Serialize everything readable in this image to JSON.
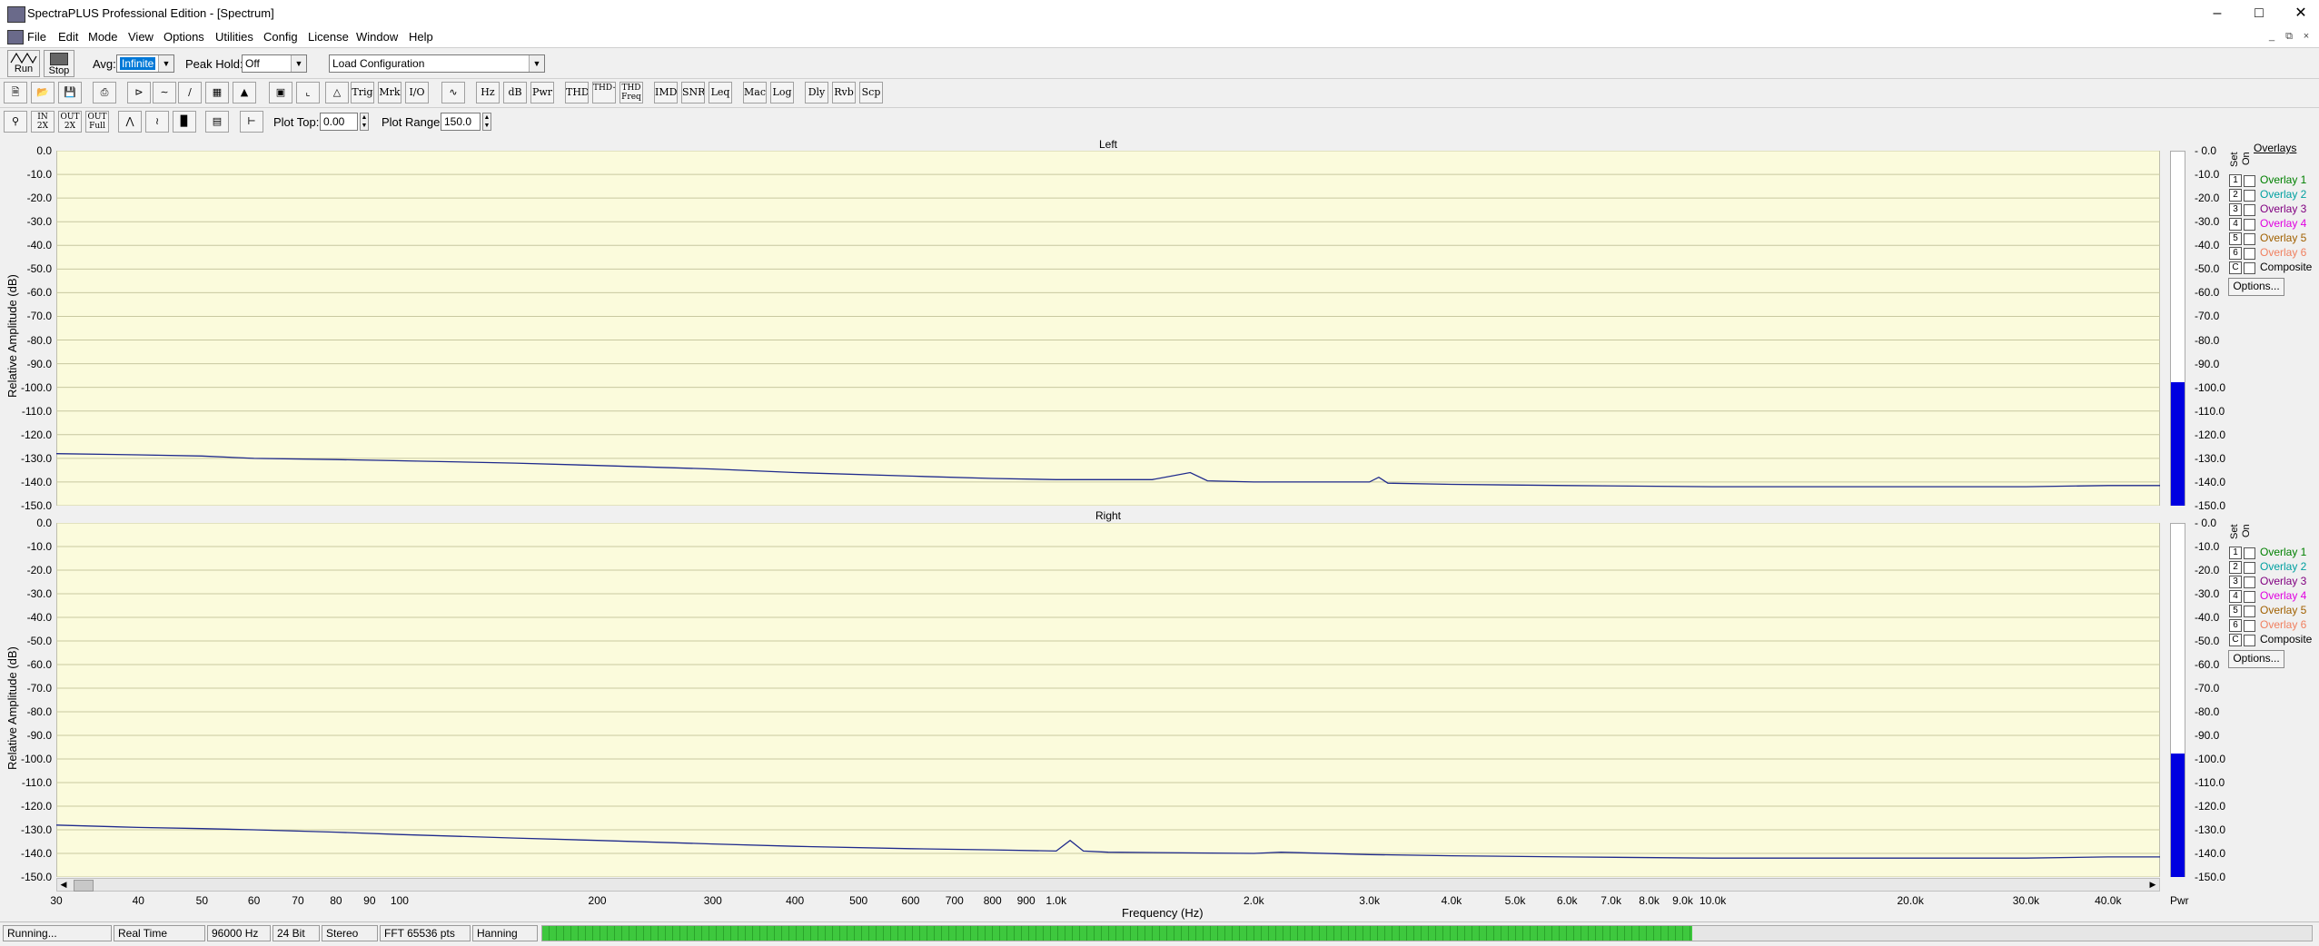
{
  "window": {
    "title": "SpectraPLUS Professional Edition - [Spectrum]"
  },
  "menu": [
    "File",
    "Edit",
    "Mode",
    "View",
    "Options",
    "Utilities",
    "Config",
    "License",
    "Window",
    "Help"
  ],
  "toolbar1": {
    "run_label": "Run",
    "stop_label": "Stop",
    "avg_label": "Avg:",
    "avg_value": "Infinite",
    "peak_label": "Peak Hold:",
    "peak_value": "Off",
    "config_value": "Load Configuration"
  },
  "toolbar2": {
    "buttons": [
      "Trig",
      "Mrk",
      "I/O",
      "Hz",
      "dB",
      "Pwr",
      "THD",
      "THD+N",
      "THD Freq",
      "IMD",
      "SNR",
      "Leq",
      "Mac",
      "Log",
      "Dly",
      "Rvb",
      "Scp"
    ]
  },
  "toolbar3": {
    "zoom_labels": [
      "IN 2X",
      "OUT 2X",
      "OUT Full"
    ],
    "plot_top_label": "Plot Top:",
    "plot_top_value": "0.00",
    "plot_range_label": "Plot Range:",
    "plot_range_value": "150.0"
  },
  "plots": {
    "left_title": "Left",
    "right_title": "Right",
    "ylabel": "Relative Amplitude (dB)",
    "xlabel": "Frequency (Hz)",
    "y_ticks": [
      "0.0",
      "-10.0",
      "-20.0",
      "-30.0",
      "-40.0",
      "-50.0",
      "-60.0",
      "-70.0",
      "-80.0",
      "-90.0",
      "-100.0",
      "-110.0",
      "-120.0",
      "-130.0",
      "-140.0",
      "-150.0"
    ],
    "x_ticks": [
      "30",
      "40",
      "50",
      "60",
      "70",
      "80",
      "90",
      "100",
      "200",
      "300",
      "400",
      "500",
      "600",
      "700",
      "800",
      "900",
      "1.0k",
      "2.0k",
      "3.0k",
      "4.0k",
      "5.0k",
      "6.0k",
      "7.0k",
      "8.0k",
      "9.0k",
      "10.0k",
      "20.0k",
      "30.0k",
      "40.0k"
    ],
    "pwr_label": "Pwr",
    "plot_bg": "#fbfbdc",
    "trace_color": "#1f2a8c",
    "meter_color": "#0000e0"
  },
  "overlays": {
    "header": "Overlays",
    "set_label": "Set",
    "on_label": "On",
    "items": [
      {
        "num": "1",
        "name": "Overlay 1",
        "color": "#008000"
      },
      {
        "num": "2",
        "name": "Overlay 2",
        "color": "#00a0a0"
      },
      {
        "num": "3",
        "name": "Overlay 3",
        "color": "#800080"
      },
      {
        "num": "4",
        "name": "Overlay 4",
        "color": "#e000e0"
      },
      {
        "num": "5",
        "name": "Overlay 5",
        "color": "#a06000"
      },
      {
        "num": "6",
        "name": "Overlay 6",
        "color": "#f08060"
      },
      {
        "num": "C",
        "name": "Composite",
        "color": "#000000"
      }
    ],
    "options_label": "Options..."
  },
  "chart_data": [
    {
      "type": "line",
      "title": "Left",
      "xlabel": "Frequency (Hz)",
      "ylabel": "Relative Amplitude (dB)",
      "x_scale": "log",
      "xlim": [
        30,
        48000
      ],
      "ylim": [
        -150,
        0
      ],
      "grid": true,
      "series": [
        {
          "x": [
            30,
            40,
            50,
            60,
            80,
            100,
            150,
            200,
            300,
            400,
            600,
            800,
            1000,
            1400,
            1600,
            1700,
            2000,
            3000,
            3100,
            3200,
            4000,
            6000,
            10000,
            20000,
            30000,
            40000,
            48000
          ],
          "values": [
            -128,
            -128.5,
            -129,
            -130,
            -130.5,
            -131,
            -132,
            -133,
            -134.5,
            -136,
            -137.5,
            -138.5,
            -139,
            -139,
            -136,
            -139.5,
            -140,
            -140,
            -138,
            -140.5,
            -141,
            -141.5,
            -142,
            -142,
            -142,
            -141.5,
            -141.5
          ]
        }
      ]
    },
    {
      "type": "line",
      "title": "Right",
      "xlabel": "Frequency (Hz)",
      "ylabel": "Relative Amplitude (dB)",
      "x_scale": "log",
      "xlim": [
        30,
        48000
      ],
      "ylim": [
        -150,
        0
      ],
      "grid": true,
      "series": [
        {
          "x": [
            30,
            40,
            50,
            60,
            80,
            100,
            150,
            200,
            300,
            400,
            600,
            800,
            1000,
            1050,
            1100,
            1200,
            2000,
            2200,
            3000,
            4000,
            6000,
            10000,
            20000,
            30000,
            40000,
            48000
          ],
          "values": [
            -128,
            -129,
            -129.5,
            -130,
            -131,
            -132,
            -133.5,
            -134.5,
            -136,
            -137,
            -138,
            -138.5,
            -139,
            -134.5,
            -139,
            -139.5,
            -140,
            -139.5,
            -140.5,
            -141,
            -141.5,
            -142,
            -142,
            -142,
            -141.5,
            -141.5
          ]
        }
      ]
    }
  ],
  "status": {
    "items": [
      "Running...",
      "Real Time",
      "96000 Hz",
      "24 Bit",
      "Stereo",
      "FFT 65536 pts",
      "Hanning"
    ],
    "progress": 0.65,
    "progress_color": "#3ec83e"
  }
}
